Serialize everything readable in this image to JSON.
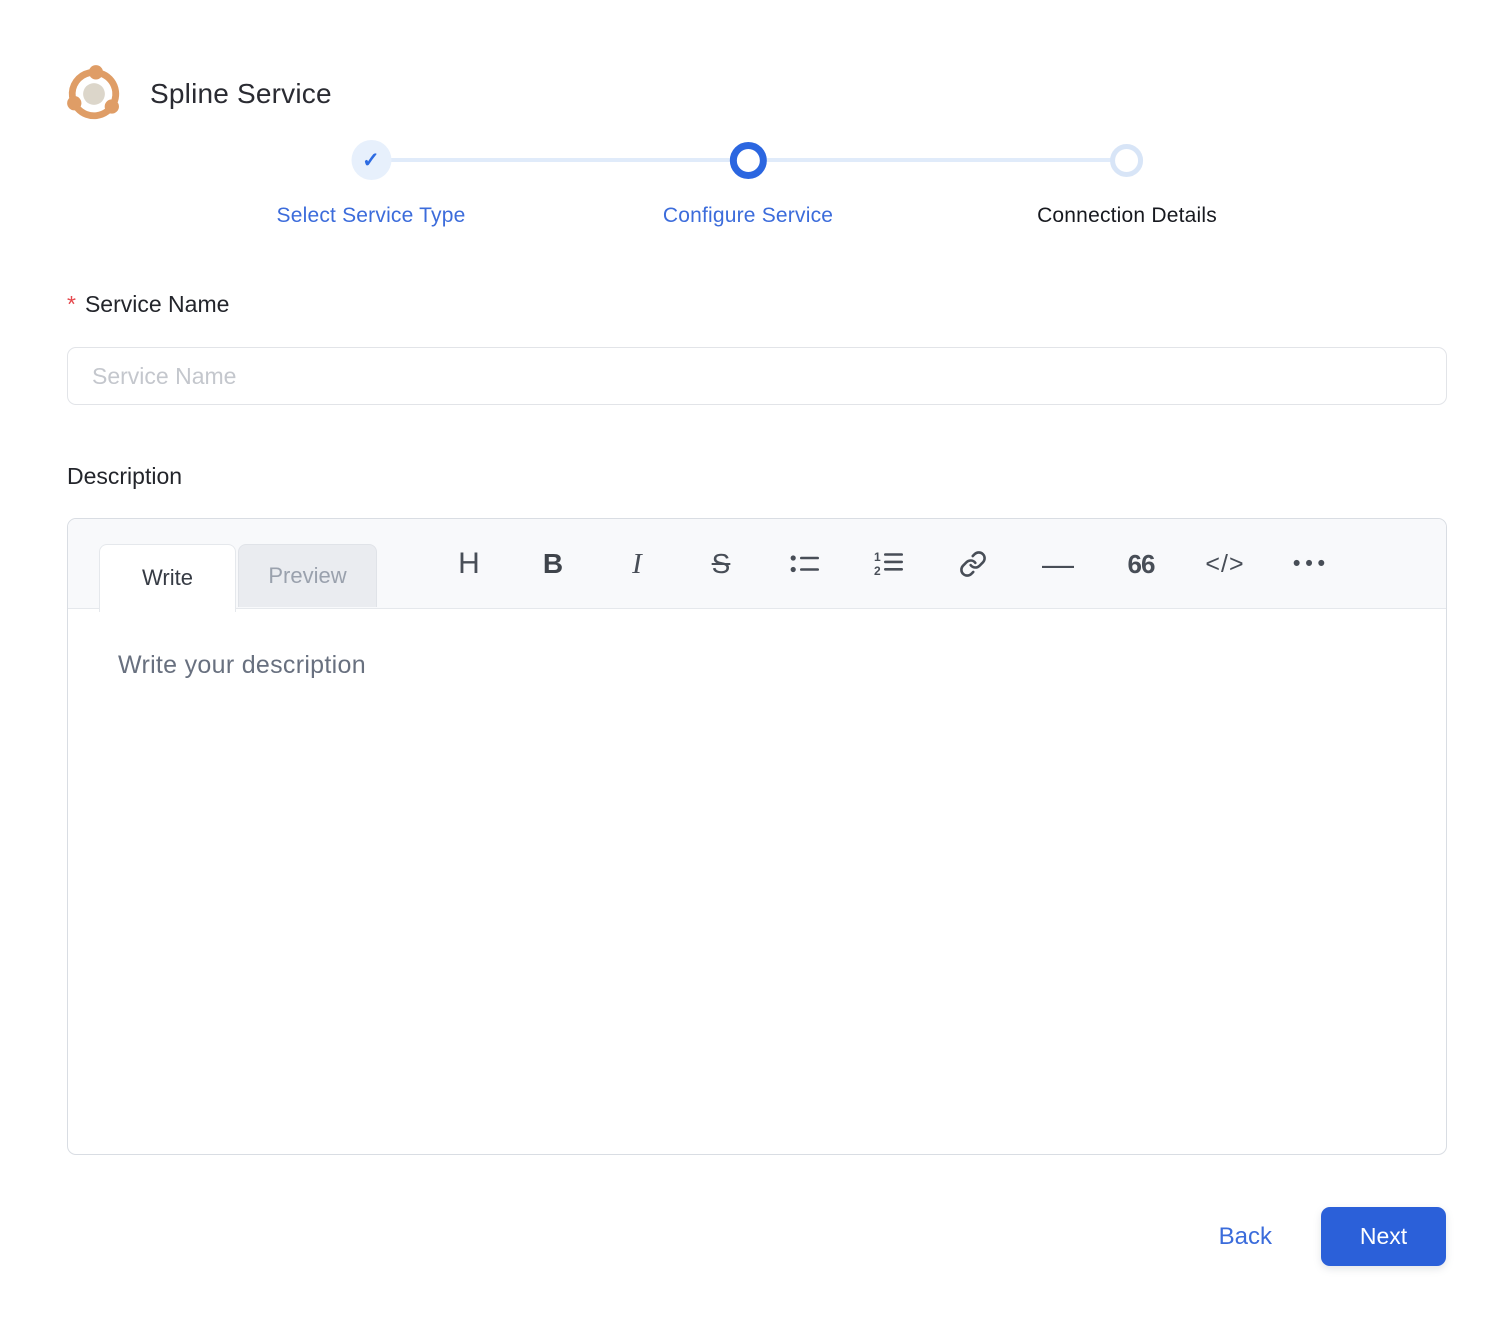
{
  "header": {
    "title": "Spline Service",
    "icon": "spline-service-logo"
  },
  "stepper": {
    "check_glyph": "✓",
    "steps": [
      {
        "label": "Select Service Type",
        "state": "completed"
      },
      {
        "label": "Configure Service",
        "state": "active"
      },
      {
        "label": "Connection Details",
        "state": "upcoming"
      }
    ]
  },
  "form": {
    "service_name": {
      "label": "Service Name",
      "required_marker": "*",
      "value": "",
      "placeholder": "Service Name"
    },
    "description": {
      "label": "Description",
      "tabs": [
        {
          "label": "Write",
          "active": true
        },
        {
          "label": "Preview",
          "active": false
        }
      ],
      "toolbar": [
        {
          "name": "heading-icon",
          "glyph": "H"
        },
        {
          "name": "bold-icon",
          "glyph": "B"
        },
        {
          "name": "italic-icon",
          "glyph": "I"
        },
        {
          "name": "strikethrough-icon",
          "glyph": "S"
        },
        {
          "name": "bullet-list-icon"
        },
        {
          "name": "numbered-list-icon"
        },
        {
          "name": "chain-link-icon"
        },
        {
          "name": "horizontal-rule-icon",
          "glyph": "—"
        },
        {
          "name": "quote-icon",
          "glyph": "66"
        },
        {
          "name": "code-icon",
          "glyph": "</>"
        },
        {
          "name": "more-options-icon",
          "glyph": "•••"
        }
      ],
      "value": "",
      "placeholder": "Write your description"
    }
  },
  "footer": {
    "back_label": "Back",
    "next_label": "Next"
  },
  "colors": {
    "primary_blue": "#2b60d9",
    "active_ring_blue": "#2b66e0",
    "step_label_blue": "#3c6cdb",
    "completed_bg_blue": "#e7f0fc",
    "connector_blue": "#e0ebfa",
    "logo_orange": "#df9d66",
    "asterisk_red": "#e5484d"
  }
}
